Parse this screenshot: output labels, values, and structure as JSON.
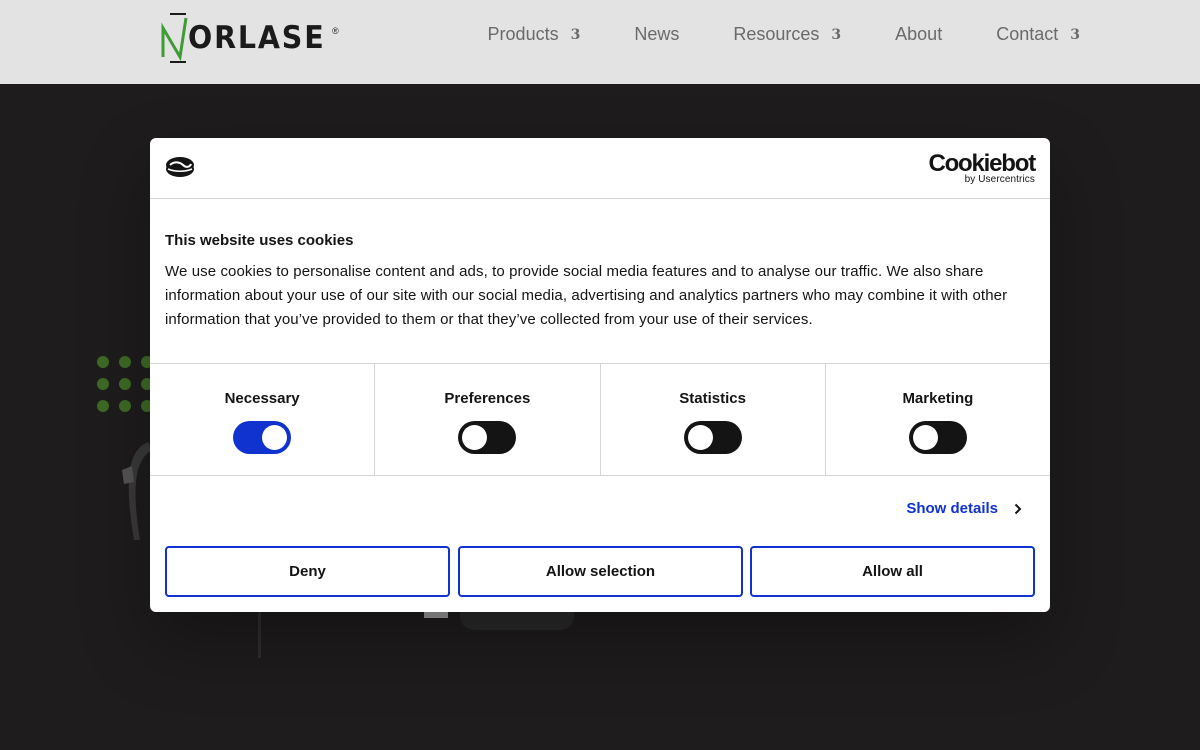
{
  "header": {
    "logo_text": "ORLASE",
    "logo_reg": "®",
    "nav": [
      {
        "label": "Products",
        "caret": "3"
      },
      {
        "label": "News",
        "caret": ""
      },
      {
        "label": "Resources",
        "caret": "3"
      },
      {
        "label": "About",
        "caret": ""
      },
      {
        "label": "Contact",
        "caret": "3"
      }
    ]
  },
  "colors": {
    "accent": "#1032cf",
    "brand_green": "#3f9b36",
    "background": "#1e1c1d",
    "header_bg": "#e3e3e3"
  },
  "cookie_dialog": {
    "brand_name": "Cookiebot",
    "brand_sub": "by Usercentrics",
    "title": "This website uses cookies",
    "body": "We use cookies to personalise content and ads, to provide social media features and to analyse our traffic. We also share information about your use of our site with our social media, advertising and analytics partners who may combine it with other information that you’ve provided to them or that they’ve collected from your use of their services.",
    "categories": [
      {
        "label": "Necessary",
        "enabled": true
      },
      {
        "label": "Preferences",
        "enabled": false
      },
      {
        "label": "Statistics",
        "enabled": false
      },
      {
        "label": "Marketing",
        "enabled": false
      }
    ],
    "show_details": "Show details",
    "buttons": {
      "deny": "Deny",
      "allow_selection": "Allow selection",
      "allow_all": "Allow all"
    }
  }
}
